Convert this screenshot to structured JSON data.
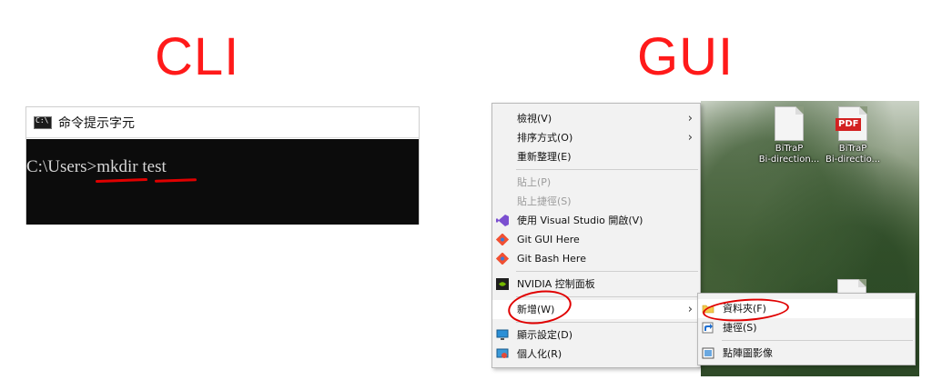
{
  "headings": {
    "cli": "CLI",
    "gui": "GUI"
  },
  "cmd": {
    "window_title": "命令提示字元",
    "prompt": "C:\\Users>",
    "command": "mkdir",
    "argument": "test"
  },
  "context_menu": {
    "items": [
      {
        "label": "檢視(V)",
        "submenu": true,
        "disabled": false
      },
      {
        "label": "排序方式(O)",
        "submenu": true,
        "disabled": false
      },
      {
        "label": "重新整理(E)",
        "submenu": false,
        "disabled": false
      },
      {
        "label": "貼上(P)",
        "submenu": false,
        "disabled": true
      },
      {
        "label": "貼上捷徑(S)",
        "submenu": false,
        "disabled": true
      },
      {
        "label": "使用 Visual Studio 開啟(V)",
        "submenu": false,
        "disabled": false,
        "icon": "visual-studio-icon"
      },
      {
        "label": "Git GUI Here",
        "submenu": false,
        "disabled": false,
        "icon": "git-icon"
      },
      {
        "label": "Git Bash Here",
        "submenu": false,
        "disabled": false,
        "icon": "git-icon"
      },
      {
        "label": "NVIDIA 控制面板",
        "submenu": false,
        "disabled": false,
        "icon": "nvidia-icon"
      },
      {
        "label": "新增(W)",
        "submenu": true,
        "disabled": false,
        "highlighted": true
      },
      {
        "label": "顯示設定(D)",
        "submenu": false,
        "disabled": false,
        "icon": "display-icon"
      },
      {
        "label": "個人化(R)",
        "submenu": false,
        "disabled": false,
        "icon": "personalize-icon"
      }
    ]
  },
  "submenu": {
    "items": [
      {
        "label": "資料夾(F)",
        "icon": "folder-icon"
      },
      {
        "label": "捷徑(S)",
        "icon": "shortcut-icon"
      },
      {
        "label": "點陣圖影像",
        "icon": "bitmap-icon"
      }
    ]
  },
  "desktop_icons": [
    {
      "line1": "BiTraP",
      "line2": "Bi-direction...",
      "type": "file"
    },
    {
      "line1": "BiTraP",
      "line2": "Bi-directio...",
      "type": "pdf",
      "badge": "PDF"
    }
  ],
  "colors": {
    "annotation": "#e00000",
    "title": "#ff1a1a",
    "terminal_bg": "#0c0c0c"
  }
}
